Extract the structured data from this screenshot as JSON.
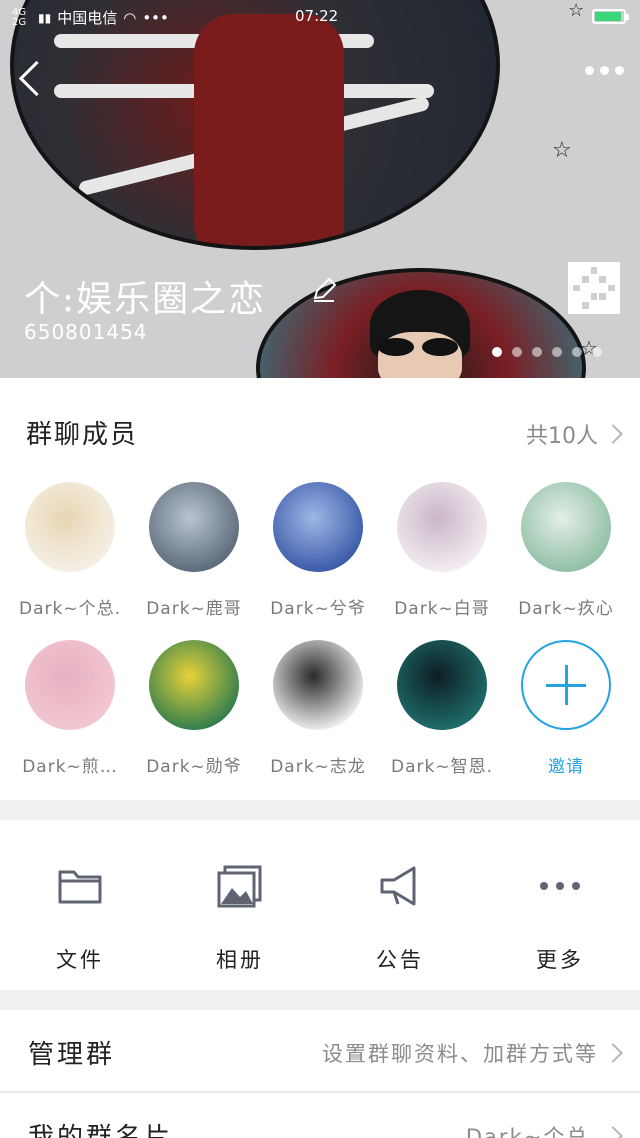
{
  "status_bar": {
    "network": "4G 2G",
    "carrier": "中国电信",
    "time": "07:22",
    "battery_level": 0.85
  },
  "header": {
    "group_name": "个:娱乐圈之恋",
    "group_id": "650801454",
    "carousel_pages": 6,
    "carousel_active_index": 0
  },
  "members": {
    "title": "群聊成员",
    "count_label": "共10人",
    "list": [
      {
        "name": "Dark~个总.",
        "avatar_colors": [
          "#f5f0e6",
          "#e8d6b3"
        ]
      },
      {
        "name": "Dark~鹿哥",
        "avatar_colors": [
          "#5b6a7a",
          "#b9c4cf"
        ]
      },
      {
        "name": "Dark~兮爷",
        "avatar_colors": [
          "#3a5aa8",
          "#9fb7e6"
        ]
      },
      {
        "name": "Dark~白哥",
        "avatar_colors": [
          "#f3edf2",
          "#c9b6c6"
        ]
      },
      {
        "name": "Dark~疚心",
        "avatar_colors": [
          "#8fbfa3",
          "#e4eee8"
        ]
      },
      {
        "name": "Dark~煎…",
        "avatar_colors": [
          "#f2c7d2",
          "#e7b0c0"
        ]
      },
      {
        "name": "Dark~勋爷",
        "avatar_colors": [
          "#2f7d4d",
          "#e8d23a"
        ]
      },
      {
        "name": "Dark~志龙",
        "avatar_colors": [
          "#f1eeee",
          "#2a2a2a"
        ]
      },
      {
        "name": "Dark~智恩.",
        "avatar_colors": [
          "#1d6e6a",
          "#0f1d24"
        ]
      }
    ],
    "invite_label": "邀请"
  },
  "actions": [
    {
      "label": "文件",
      "icon": "folder-icon"
    },
    {
      "label": "相册",
      "icon": "album-icon"
    },
    {
      "label": "公告",
      "icon": "megaphone-icon"
    },
    {
      "label": "更多",
      "icon": "more-dots-icon"
    }
  ],
  "rows": {
    "manage": {
      "title": "管理群",
      "value": "设置群聊资料、加群方式等"
    },
    "my_card": {
      "title": "我的群名片",
      "value": "Dark~个总."
    }
  },
  "colors": {
    "accent": "#24a3e3",
    "battery": "#3ad67a"
  }
}
